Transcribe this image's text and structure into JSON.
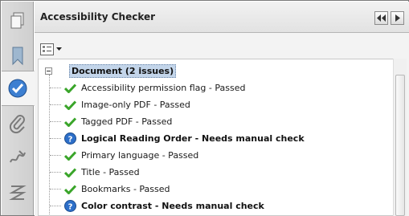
{
  "panel": {
    "title": "Accessibility Checker"
  },
  "tree": {
    "root_label": "Document (2 issues)",
    "items": [
      {
        "label": "Accessibility permission flag - Passed",
        "status": "passed"
      },
      {
        "label": "Image-only PDF - Passed",
        "status": "passed"
      },
      {
        "label": "Tagged PDF - Passed",
        "status": "passed"
      },
      {
        "label": "Logical Reading Order - Needs manual check",
        "status": "manual"
      },
      {
        "label": "Primary language - Passed",
        "status": "passed"
      },
      {
        "label": "Title - Passed",
        "status": "passed"
      },
      {
        "label": "Bookmarks - Passed",
        "status": "passed"
      },
      {
        "label": "Color contrast - Needs manual check",
        "status": "manual"
      }
    ]
  },
  "icons": {
    "rail": [
      "pages-icon",
      "bookmark-icon",
      "accessibility-check-icon",
      "attachment-icon",
      "signature-icon",
      "content-order-icon"
    ],
    "passed": "green-check-icon",
    "manual": "blue-question-icon"
  },
  "colors": {
    "pass_green": "#3aa52a",
    "manual_blue": "#2d6fc9",
    "selection": "#c3d5ea"
  }
}
